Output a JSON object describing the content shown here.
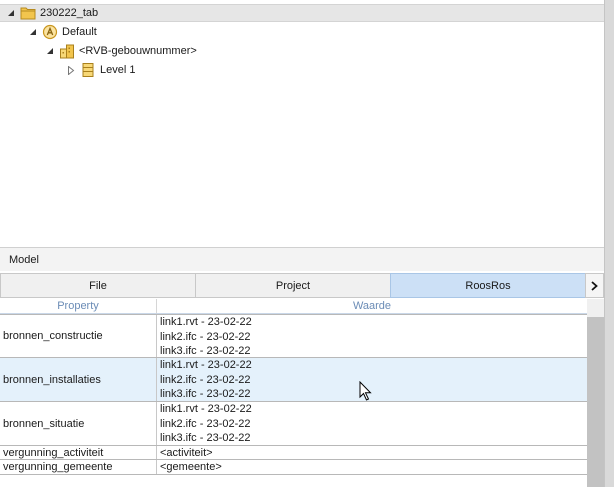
{
  "tree": {
    "root": {
      "label": "230222_tab"
    },
    "view": {
      "label": "Default"
    },
    "building": {
      "label": "<RVB-gebouwnummer>"
    },
    "level": {
      "label": "Level 1"
    }
  },
  "model_panel": {
    "title": "Model",
    "tabs": [
      {
        "label": "File"
      },
      {
        "label": "Project"
      },
      {
        "label": "RoosRos"
      }
    ],
    "active_tab": "RoosRos",
    "columns": {
      "property": "Property",
      "value": "Waarde"
    },
    "rows": [
      {
        "property": "bronnen_constructie",
        "values": [
          "link1.rvt - 23-02-22",
          "link2.ifc - 23-02-22",
          "link3.ifc - 23-02-22"
        ]
      },
      {
        "property": "bronnen_installaties",
        "values": [
          "link1.rvt - 23-02-22",
          "link2.ifc - 23-02-22",
          "link3.ifc - 23-02-22"
        ]
      },
      {
        "property": "bronnen_situatie",
        "values": [
          "link1.rvt - 23-02-22",
          "link2.ifc - 23-02-22",
          "link3.ifc - 23-02-22"
        ]
      },
      {
        "property": "vergunning_activiteit",
        "values": [
          "<activiteit>"
        ]
      },
      {
        "property": "vergunning_gemeente",
        "values": [
          "<gemeente>"
        ]
      }
    ]
  },
  "icons": {
    "root": "folder-icon",
    "view": "view-badge-icon",
    "building": "building-icon",
    "level": "level-icon"
  },
  "colors": {
    "active_tab": "#cce0f6",
    "highlight_row": "#e4f1fb",
    "header_text": "#6b8cb6",
    "folder": "#e8b43c"
  }
}
